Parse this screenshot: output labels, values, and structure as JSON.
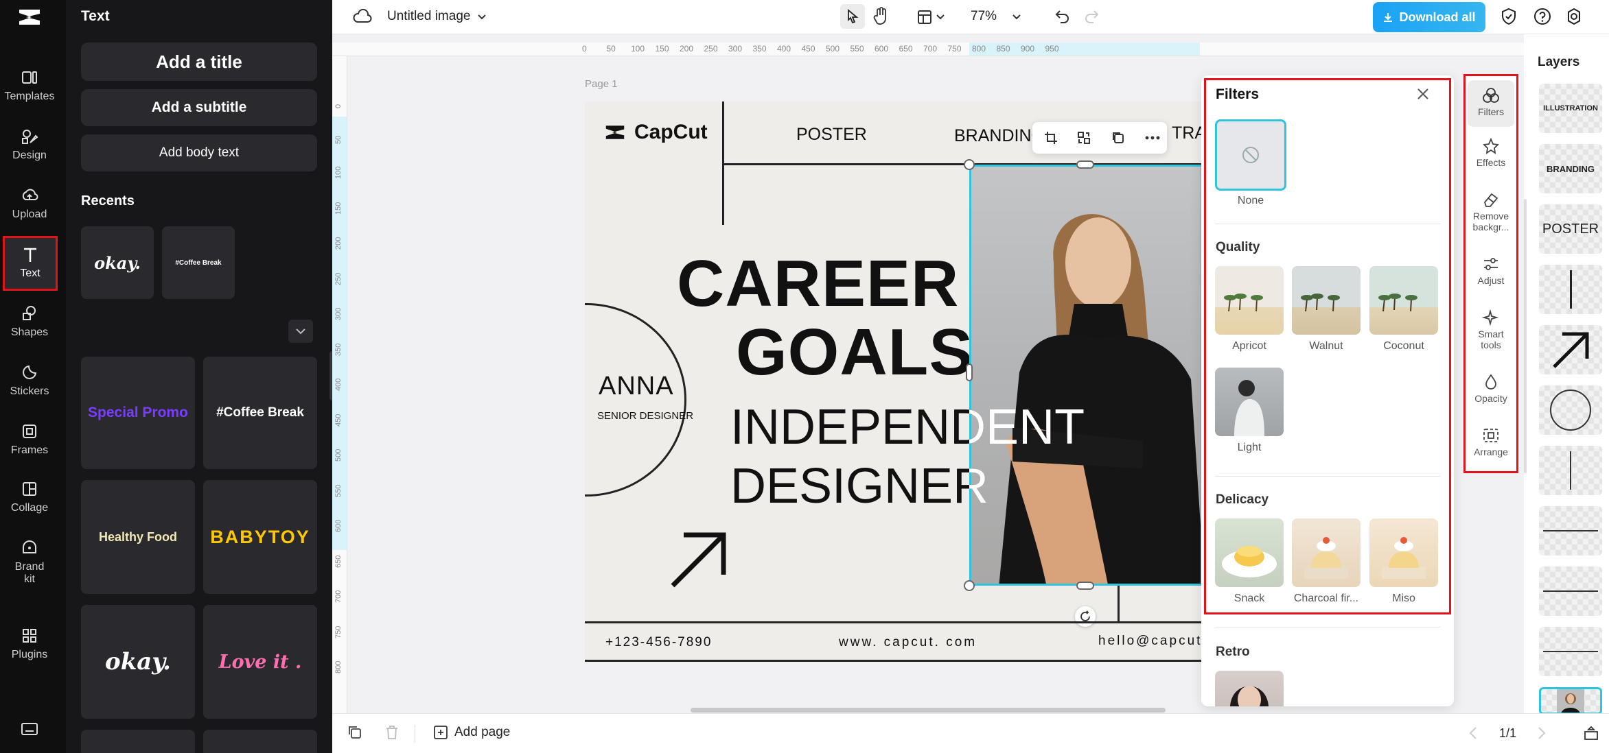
{
  "rail": {
    "items": [
      {
        "label": "Templates",
        "icon": "templates-icon"
      },
      {
        "label": "Design",
        "icon": "design-icon"
      },
      {
        "label": "Upload",
        "icon": "upload-icon"
      },
      {
        "label": "Text",
        "icon": "text-icon"
      },
      {
        "label": "Shapes",
        "icon": "shapes-icon"
      },
      {
        "label": "Stickers",
        "icon": "stickers-icon"
      },
      {
        "label": "Frames",
        "icon": "frames-icon"
      },
      {
        "label": "Collage",
        "icon": "collage-icon"
      },
      {
        "label": "Brand kit",
        "icon": "brand-kit-icon"
      },
      {
        "label": "Plugins",
        "icon": "plugins-icon"
      }
    ]
  },
  "panel": {
    "title": "Text",
    "add_title": "Add a title",
    "add_subtitle": "Add a subtitle",
    "add_body": "Add body text",
    "recents_title": "Recents",
    "recents": [
      "okay.",
      "#Coffee Break"
    ],
    "presets": [
      "Special Promo",
      "#Coffee Break",
      "Healthy Food",
      "BABYTOY",
      "okay.",
      "Love it ."
    ]
  },
  "topbar": {
    "doc_title": "Untitled image",
    "zoom": "77%",
    "download": "Download all"
  },
  "ruler": {
    "h": [
      "0",
      "50",
      "100",
      "150",
      "200",
      "250",
      "300",
      "350",
      "400",
      "450",
      "500",
      "550",
      "600",
      "650",
      "700",
      "750",
      "800",
      "850",
      "900",
      "950"
    ],
    "v": [
      "0",
      "50",
      "100",
      "150",
      "200",
      "250",
      "300",
      "350",
      "400",
      "450",
      "500",
      "550",
      "600",
      "650",
      "700",
      "750",
      "800"
    ]
  },
  "canvas": {
    "page_label": "Page 1"
  },
  "poster": {
    "logo": "CapCut",
    "nav1": "POSTER",
    "nav2": "BRANDING",
    "nav3": "TRA",
    "line1": "CAREER",
    "line2": "GOALS",
    "line3": "INDEPENDENT",
    "line4": "DESIGNER",
    "name": "ANNA",
    "role": "SENIOR DESIGNER",
    "phone": "+123-456-7890",
    "web": "www. capcut. com",
    "email": "hello@capcut"
  },
  "filters": {
    "title": "Filters",
    "none": "None",
    "sections": [
      {
        "name": "Quality",
        "items": [
          "Apricot",
          "Walnut",
          "Coconut",
          "Light"
        ]
      },
      {
        "name": "Delicacy",
        "items": [
          "Snack",
          "Charcoal fir...",
          "Miso"
        ]
      },
      {
        "name": "Retro",
        "items": []
      }
    ]
  },
  "tools": [
    "Filters",
    "Effects",
    "Remove backgr...",
    "Adjust",
    "Smart tools",
    "Opacity",
    "Arrange"
  ],
  "layers": {
    "title": "Layers",
    "thumbs": [
      "ILLUSTRATION",
      "BRANDING",
      "POSTER"
    ]
  },
  "bottombar": {
    "add_page": "Add page",
    "page_count": "1/1"
  },
  "colors": {
    "accent": "#1fb3d6",
    "download_btn": "#29a9f0",
    "highlight": "#e3131b"
  }
}
